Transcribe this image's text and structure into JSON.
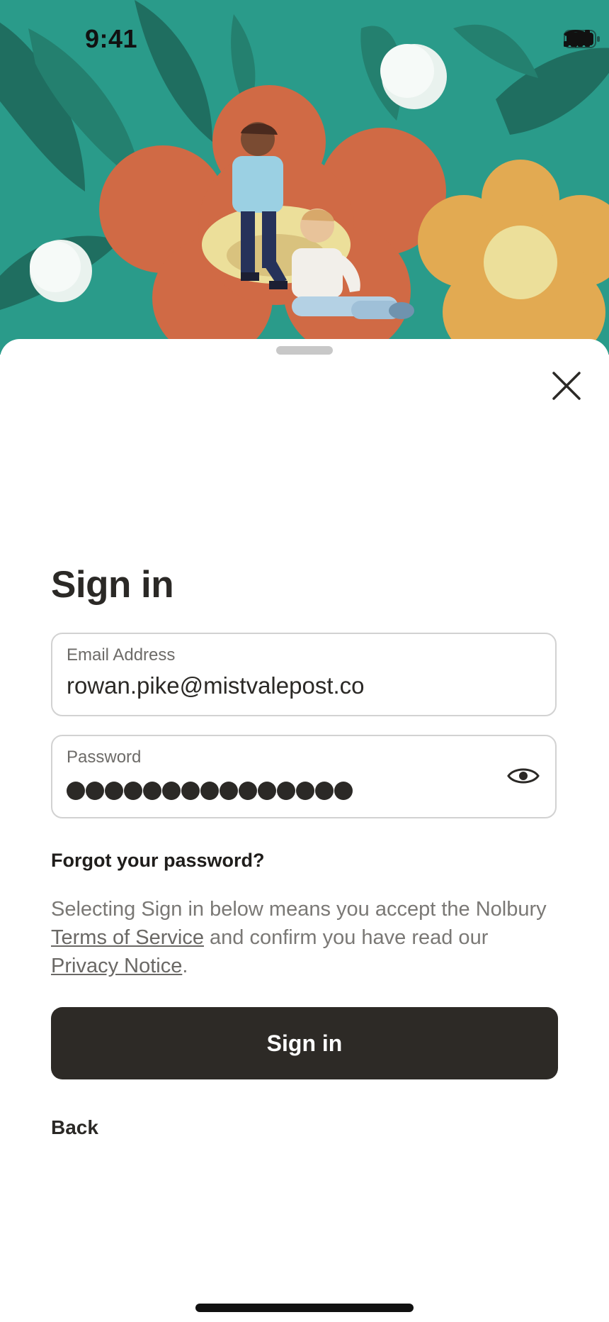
{
  "status_bar": {
    "time": "9:41"
  },
  "sheet": {
    "title": "Sign in",
    "email": {
      "label": "Email Address",
      "value": "rowan.pike@mistvalepost.co"
    },
    "password": {
      "label": "Password",
      "masked_length": 15
    },
    "forgot_label": "Forgot your password?",
    "legal": {
      "part1": "Selecting Sign in below means you accept the Nolbury ",
      "terms_link": "Terms of Service",
      "part2": " and confirm you have read our ",
      "privacy_link": "Privacy Notice",
      "part3": "."
    },
    "signin_button": "Sign in",
    "back_label": "Back"
  },
  "icons": {
    "close": "close-icon",
    "eye": "eye-icon",
    "signal": "signal-icon",
    "wifi": "wifi-icon",
    "battery": "battery-icon"
  },
  "colors": {
    "hero_background": "#2a9b8a",
    "primary_button": "#2d2a26",
    "text_primary": "#2b2926",
    "text_secondary": "#7a7875"
  }
}
